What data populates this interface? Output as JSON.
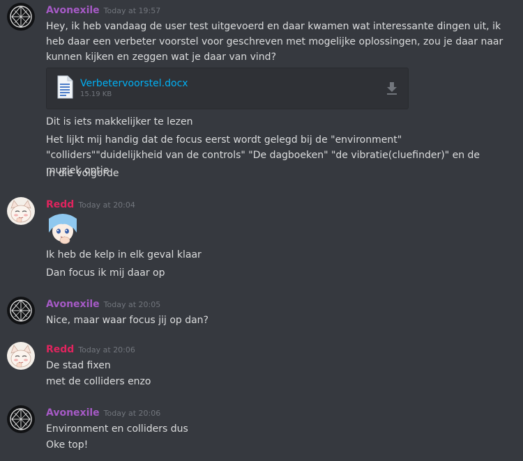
{
  "colors": {
    "background": "#36393f",
    "avonexile": "#a65ac6",
    "redd": "#e0245e",
    "link": "#00b0f4",
    "timestamp": "#72767d"
  },
  "messages": [
    {
      "author": "Avonexile",
      "timestamp": "Today at 19:57",
      "avatar": "avonexile-avatar",
      "lines": [
        "Hey, ik heb vandaag de user test uitgevoerd en daar kwamen wat interessante dingen uit, ik heb daar een verbeter voorstel voor geschreven met mogelijke oplossingen, zou je daar naar kunnen kijken en zeggen wat je daar van vind?"
      ],
      "attachment": {
        "file_name": "Verbetervoorstel.docx",
        "file_size": "15.19 KB",
        "icon": "document-icon",
        "download_icon": "download-icon"
      },
      "follow_lines": [
        "Dit is iets makkelijker te lezen",
        "Het lijkt mij handig dat de focus eerst wordt gelegd bij de \"environment\" \"colliders\"\"duidelijkheid van de controls\" \"De dagboeken\" \"de vibratie(cluefinder)\" en de muziek optie",
        "In die volgorde"
      ]
    },
    {
      "author": "Redd",
      "timestamp": "Today at 20:04",
      "avatar": "redd-avatar",
      "sticker": "anime-emote",
      "lines": [
        "Ik heb de kelp in elk geval klaar",
        "Dan focus ik mij daar op"
      ]
    },
    {
      "author": "Avonexile",
      "timestamp": "Today at 20:05",
      "avatar": "avonexile-avatar",
      "lines": [
        "Nice, maar waar focus jij op dan?"
      ]
    },
    {
      "author": "Redd",
      "timestamp": "Today at 20:06",
      "avatar": "redd-avatar",
      "lines": [
        "De stad fixen",
        "met de colliders enzo"
      ]
    },
    {
      "author": "Avonexile",
      "timestamp": "Today at 20:06",
      "avatar": "avonexile-avatar",
      "lines": [
        "Environment en colliders dus",
        "Oke top!"
      ]
    }
  ]
}
